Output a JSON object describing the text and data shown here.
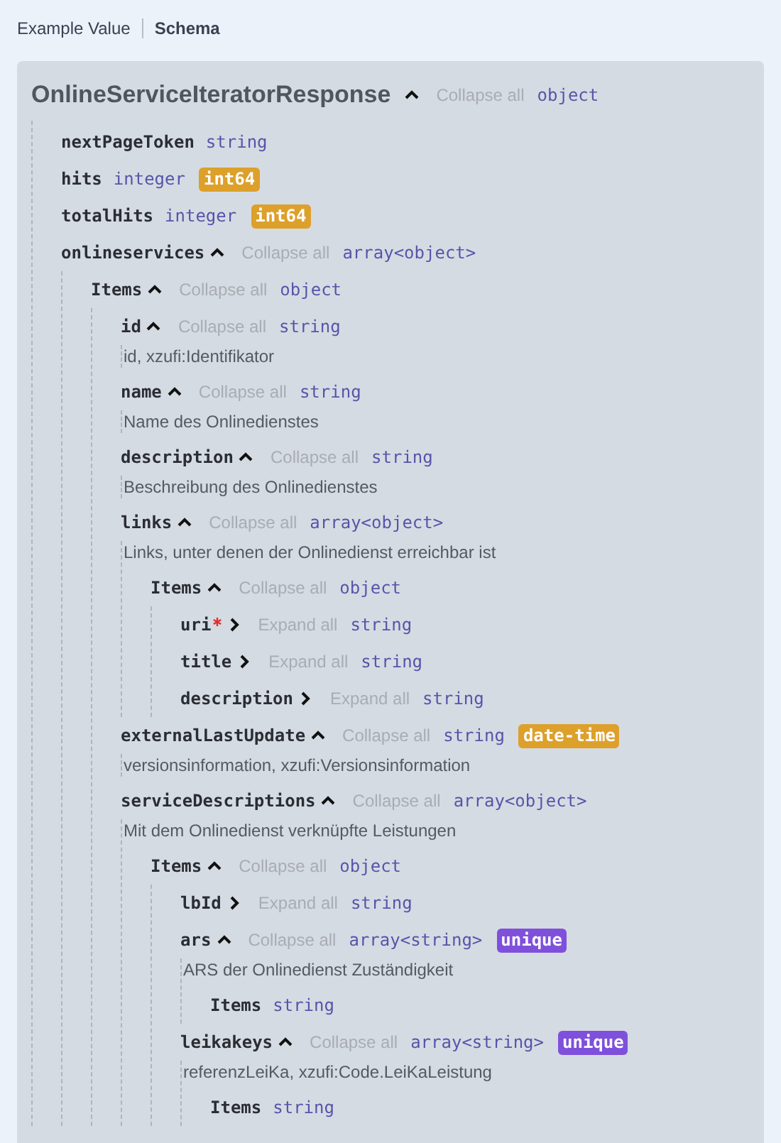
{
  "tabs": [
    {
      "label": "Example Value",
      "selected": false
    },
    {
      "label": "Schema",
      "selected": true
    }
  ],
  "schema": {
    "name": "OnlineServiceIteratorResponse",
    "expanded": true,
    "toggle_label": "Collapse all",
    "type": "object",
    "children": [
      {
        "name": "nextPageToken",
        "type": "string"
      },
      {
        "name": "hits",
        "type": "integer",
        "badge": {
          "text": "int64",
          "kind": "format"
        }
      },
      {
        "name": "totalHits",
        "type": "integer",
        "badge": {
          "text": "int64",
          "kind": "format"
        }
      },
      {
        "name": "onlineservices",
        "expanded": true,
        "toggle_label": "Collapse all",
        "type": "array<object>",
        "children": [
          {
            "name": "Items",
            "expanded": true,
            "toggle_label": "Collapse all",
            "type": "object",
            "children": [
              {
                "name": "id",
                "expanded": true,
                "toggle_label": "Collapse all",
                "type": "string",
                "description": "id, xzufi:Identifikator"
              },
              {
                "name": "name",
                "expanded": true,
                "toggle_label": "Collapse all",
                "type": "string",
                "description": "Name des Onlinedienstes"
              },
              {
                "name": "description",
                "expanded": true,
                "toggle_label": "Collapse all",
                "type": "string",
                "description": "Beschreibung des Onlinedienstes"
              },
              {
                "name": "links",
                "expanded": true,
                "toggle_label": "Collapse all",
                "type": "array<object>",
                "description": "Links, unter denen der Onlinedienst erreichbar ist",
                "children": [
                  {
                    "name": "Items",
                    "expanded": true,
                    "toggle_label": "Collapse all",
                    "type": "object",
                    "children": [
                      {
                        "name": "uri",
                        "required": true,
                        "expanded": false,
                        "toggle_label": "Expand all",
                        "type": "string"
                      },
                      {
                        "name": "title",
                        "expanded": false,
                        "toggle_label": "Expand all",
                        "type": "string"
                      },
                      {
                        "name": "description",
                        "expanded": false,
                        "toggle_label": "Expand all",
                        "type": "string"
                      }
                    ]
                  }
                ]
              },
              {
                "name": "externalLastUpdate",
                "expanded": true,
                "toggle_label": "Collapse all",
                "type": "string",
                "badge": {
                  "text": "date-time",
                  "kind": "format"
                },
                "description": "versionsinformation, xzufi:Versionsinformation"
              },
              {
                "name": "serviceDescriptions",
                "expanded": true,
                "toggle_label": "Collapse all",
                "type": "array<object>",
                "description": "Mit dem Onlinedienst verknüpfte Leistungen",
                "children": [
                  {
                    "name": "Items",
                    "expanded": true,
                    "toggle_label": "Collapse all",
                    "type": "object",
                    "children": [
                      {
                        "name": "lbId",
                        "expanded": false,
                        "toggle_label": "Expand all",
                        "type": "string"
                      },
                      {
                        "name": "ars",
                        "expanded": true,
                        "toggle_label": "Collapse all",
                        "type": "array<string>",
                        "badge": {
                          "text": "unique",
                          "kind": "unique"
                        },
                        "description": "ARS der Onlinedienst Zuständigkeit",
                        "children": [
                          {
                            "name": "Items",
                            "type": "string"
                          }
                        ]
                      },
                      {
                        "name": "leikakeys",
                        "expanded": true,
                        "toggle_label": "Collapse all",
                        "type": "array<string>",
                        "badge": {
                          "text": "unique",
                          "kind": "unique"
                        },
                        "description": "referenzLeiKa, xzufi:Code.LeiKaLeistung",
                        "children": [
                          {
                            "name": "Items",
                            "type": "string"
                          }
                        ]
                      }
                    ]
                  }
                ]
              }
            ]
          }
        ]
      }
    ]
  }
}
